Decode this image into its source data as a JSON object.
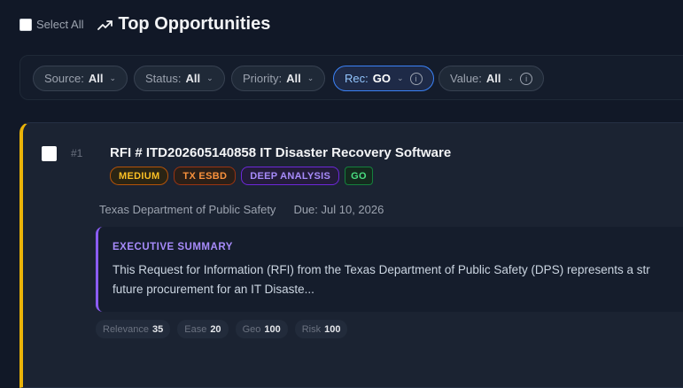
{
  "header": {
    "select_all_label": "Select All",
    "title": "Top Opportunities"
  },
  "filters": [
    {
      "label": "Source:",
      "value": "All",
      "info": false
    },
    {
      "label": "Status:",
      "value": "All",
      "info": false
    },
    {
      "label": "Priority:",
      "value": "All",
      "info": false
    },
    {
      "label": "Rec:",
      "value": "GO",
      "info": true,
      "active": true
    },
    {
      "label": "Value:",
      "value": "All",
      "info": true
    }
  ],
  "filter_info_glyph": "i",
  "filter_caret": "⌄",
  "opportunity": {
    "rank": "#1",
    "title": "RFI # ITD202605140858 IT Disaster Recovery Software",
    "badges": {
      "priority": "MEDIUM",
      "source": "TX ESBD",
      "analysis": "DEEP ANALYSIS",
      "rec": "GO"
    },
    "agency": "Texas Department of Public Safety",
    "due": "Due: Jul 10, 2026",
    "summary_label": "EXECUTIVE SUMMARY",
    "summary_line1": "This Request for Information (RFI) from the Texas Department of Public Safety (DPS) represents a str",
    "summary_line2": "future procurement for an IT Disaste...",
    "scores": [
      {
        "label": "Relevance",
        "value": "35"
      },
      {
        "label": "Ease",
        "value": "20"
      },
      {
        "label": "Geo",
        "value": "100"
      },
      {
        "label": "Risk",
        "value": "100"
      }
    ]
  },
  "colors": {
    "accent_yellow": "#eab308",
    "accent_purple": "#8b5cf6",
    "active_blue": "#3b82f6"
  }
}
